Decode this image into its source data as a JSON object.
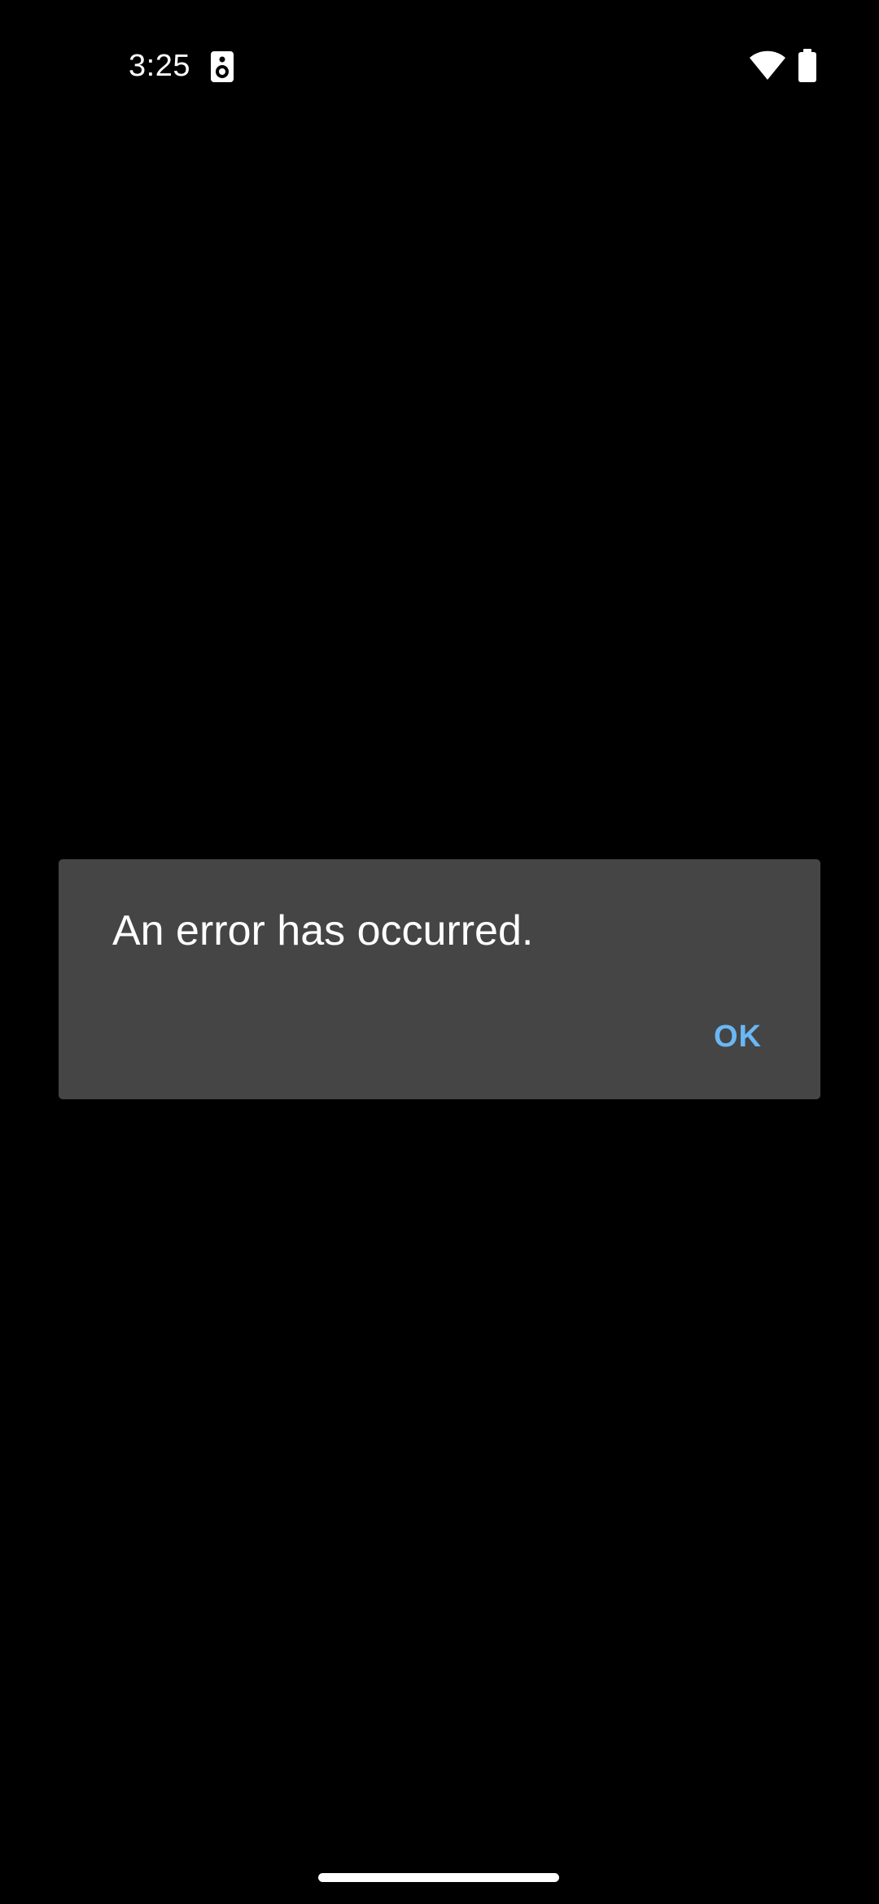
{
  "status_bar": {
    "time": "3:25",
    "icons": [
      "speaker-icon",
      "wifi-icon",
      "battery-icon"
    ]
  },
  "dialog": {
    "message": "An error has occurred.",
    "ok_label": "OK"
  },
  "colors": {
    "background": "#000000",
    "dialog_surface": "#454545",
    "accent": "#6ab7f5",
    "text": "#ffffff"
  }
}
